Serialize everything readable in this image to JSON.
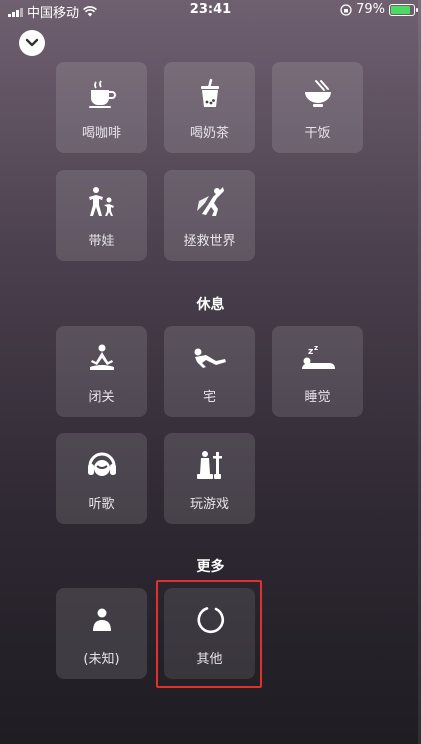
{
  "status_bar": {
    "carrier": "中国移动",
    "time": "23:41",
    "battery_percent": "79%",
    "battery_level": 0.79,
    "colors": {
      "battery_fill": "#4cd964"
    }
  },
  "collapse_icon": "chevron-down-icon",
  "activities": {
    "items": [
      {
        "label": "喝咖啡",
        "icon": "coffee-cup-icon"
      },
      {
        "label": "喝奶茶",
        "icon": "bubble-tea-icon"
      },
      {
        "label": "干饭",
        "icon": "rice-bowl-icon"
      },
      {
        "label": "带娃",
        "icon": "parent-child-icon"
      },
      {
        "label": "拯救世界",
        "icon": "superhero-icon"
      }
    ]
  },
  "rest": {
    "title": "休息",
    "items": [
      {
        "label": "闭关",
        "icon": "meditation-icon"
      },
      {
        "label": "宅",
        "icon": "lying-down-icon"
      },
      {
        "label": "睡觉",
        "icon": "sleeping-icon"
      },
      {
        "label": "听歌",
        "icon": "headphones-icon"
      },
      {
        "label": "玩游戏",
        "icon": "chess-icon"
      }
    ]
  },
  "more": {
    "title": "更多",
    "items": [
      {
        "label": "(未知)",
        "icon": "unknown-person-icon"
      },
      {
        "label": "其他",
        "icon": "circle-other-icon"
      }
    ]
  },
  "highlight_color": "#e0312b"
}
